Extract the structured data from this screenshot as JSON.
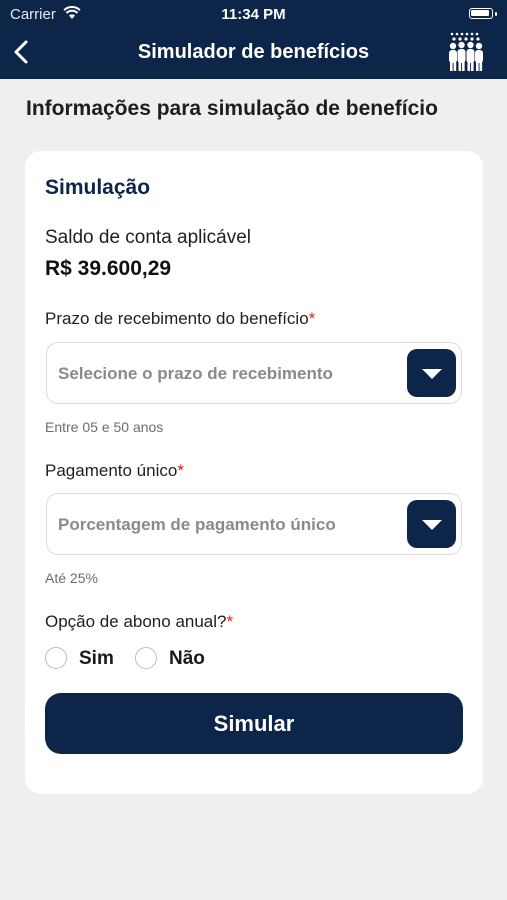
{
  "status_bar": {
    "carrier": "Carrier",
    "time": "11:34 PM"
  },
  "nav": {
    "title": "Simulador de benefícios"
  },
  "page": {
    "title": "Informações para simulação de benefício"
  },
  "card": {
    "title": "Simulação",
    "saldo_label": "Saldo de conta aplicável",
    "saldo_value": "R$ 39.600,29",
    "prazo": {
      "label": "Prazo de recebimento do benefício",
      "required": "*",
      "placeholder": "Selecione o prazo de recebimento",
      "hint": "Entre 05 e 50 anos"
    },
    "pagamento": {
      "label": "Pagamento único",
      "required": "*",
      "placeholder": "Porcentagem de pagamento único",
      "hint": "Até 25%"
    },
    "abono": {
      "label": "Opção de abono anual?",
      "required": "*",
      "options": [
        "Sim",
        "Não"
      ]
    },
    "submit_label": "Simular"
  },
  "colors": {
    "primary": "#0c2548",
    "background": "#efefef",
    "required": "#e02020"
  }
}
